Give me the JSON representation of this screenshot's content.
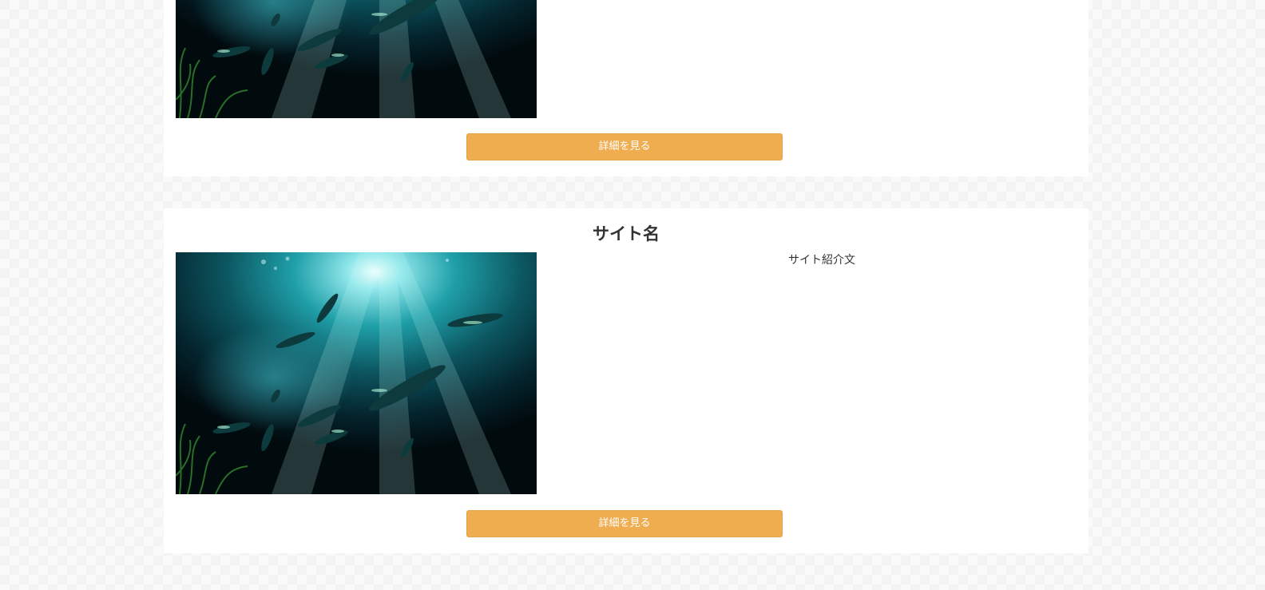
{
  "cards": [
    {
      "image_alt": "underwater-fish-photo",
      "detail_button_label": "詳細を見る"
    },
    {
      "site_name": "サイト名",
      "site_description": "サイト紹介文",
      "image_alt": "underwater-fish-photo",
      "detail_button_label": "詳細を見る"
    }
  ],
  "colors": {
    "button": "#efad50",
    "card_background": "#ffffff",
    "page_background": "#f4f4f4"
  }
}
